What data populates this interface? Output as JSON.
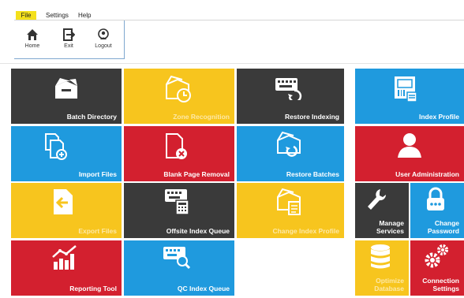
{
  "menu": {
    "file": "File",
    "settings": "Settings",
    "help": "Help"
  },
  "ribbon": {
    "home": "Home",
    "exit": "Exit",
    "logout": "Logout"
  },
  "tiles": {
    "batch_directory": "Batch Directory",
    "zone_recognition": "Zone Recognition",
    "restore_indexing": "Restore Indexing",
    "index_profile": "Index Profile",
    "import_files": "Import Files",
    "blank_page_removal": "Blank Page Removal",
    "restore_batches": "Restore Batches",
    "user_administration": "User Administration",
    "export_files": "Export Files",
    "offsite_index_queue": "Offsite Index Queue",
    "change_index_profile": "Change Index Profile",
    "manage_services": "Manage\nServices",
    "change_password": "Change\nPassword",
    "reporting_tool": "Reporting Tool",
    "qc_index_queue": "QC Index Queue",
    "optimize_database": "Optimize\nDatabase",
    "connection_settings": "Connection\nSettings"
  },
  "colors": {
    "dark": "#3a3a3a",
    "yellow": "#f7c51e",
    "blue": "#1f9ade",
    "red": "#d3202f"
  }
}
